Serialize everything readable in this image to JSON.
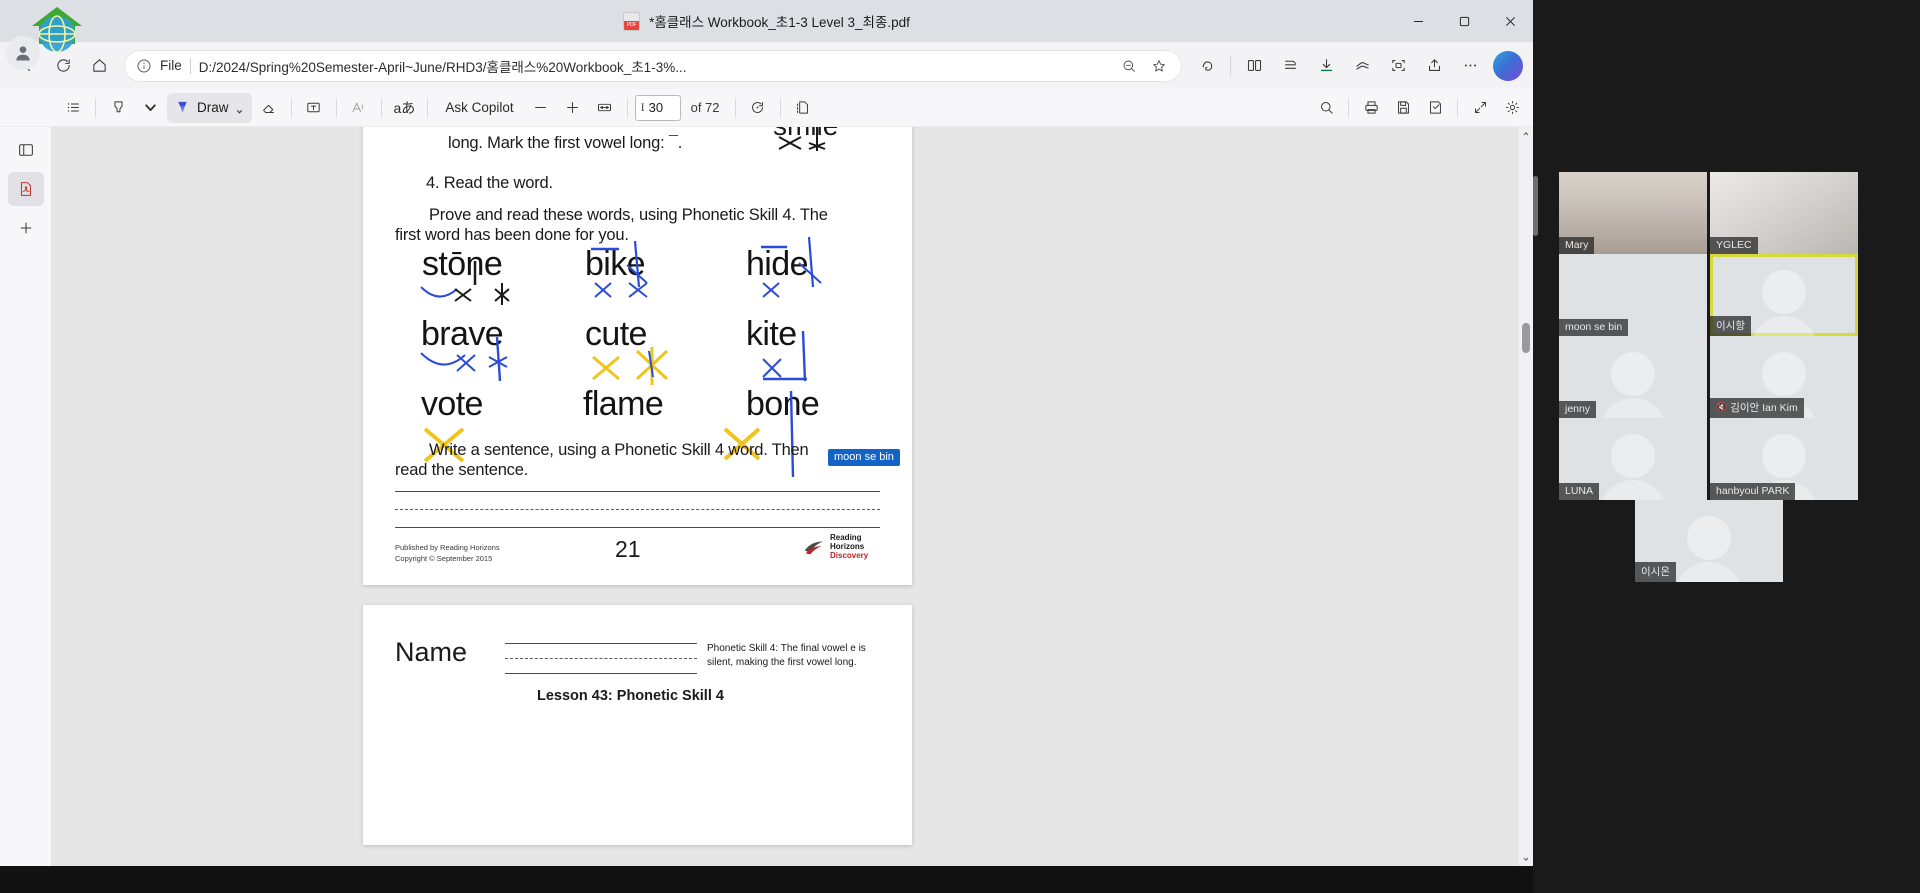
{
  "window": {
    "doc_title": "*홈클래스 Workbook_초1-3 Level 3_최종.pdf",
    "minimize_label": "Minimize",
    "restore_label": "Restore",
    "close_label": "Close"
  },
  "navbar": {
    "back_label": "Back",
    "refresh_label": "Refresh",
    "home_label": "Home",
    "file_scheme": "File",
    "url": "D:/2024/Spring%20Semester-April~June/RHD3/홈클래스%20Workbook_초1-3%...",
    "zoom_out_label": "Zoom out",
    "favorite_label": "Add this page to favorites",
    "copilot_label": "Copilot",
    "split_screen_label": "Split screen",
    "collections_label": "Collections",
    "downloads_label": "Downloads",
    "browser_essentials_label": "Browser essentials",
    "screenshot_label": "Screenshot",
    "share_label": "Share",
    "settings_more_label": "Settings and more"
  },
  "pdf_toolbar": {
    "table_of_contents_label": "Table of contents",
    "highlight_label": "Highlight",
    "draw_label": "Draw",
    "erase_label": "Erase",
    "text_label": "Add text",
    "read_aloud_label": "Read aloud",
    "translate_label": "Translate",
    "ask_copilot_label": "Ask Copilot",
    "zoom_out_label": "Zoom out",
    "zoom_in_label": "Zoom in",
    "fit_page_label": "Fit to page",
    "current_page": "30",
    "page_count_label": "of 72",
    "rotate_label": "Rotate",
    "page_view_label": "Page view",
    "find_label": "Find",
    "print_label": "Print",
    "save_label": "Save",
    "save_as_label": "Save as",
    "fullscreen_label": "Full screen",
    "settings_label": "Settings"
  },
  "pdf_sidebar": {
    "panel_label": "Toggle side panel",
    "pdf_label": "PDF tools",
    "add_label": "Add"
  },
  "worksheet": {
    "instruction_top": "long. Mark the first vowel long: ¯.",
    "step_heading": "4. Read the word.",
    "prove_line1": "Prove and read these words, using Phonetic Skill 4. The",
    "prove_line2": "first word has been done for you.",
    "words": [
      [
        "stōne",
        "bike",
        "hide"
      ],
      [
        "brave",
        "cute",
        "kite"
      ],
      [
        "vote",
        "flame",
        "bone"
      ]
    ],
    "write_line1": "Write a sentence, using a Phonetic Skill 4 word. Then",
    "write_line2": "read the sentence.",
    "annotation_label": "moon se bin",
    "footer_publisher": "Published by Reading Horizons",
    "footer_copyright": "Copyright © September 2015",
    "logo_line1": "Reading",
    "logo_line2": "Horizons",
    "logo_line3": "Discovery",
    "page_number": "21"
  },
  "worksheet_next": {
    "name_label": "Name",
    "note_line1": "Phonetic Skill 4: The final vowel e is",
    "note_line2": "silent, making the first vowel long.",
    "lesson_title": "Lesson 43: Phonetic Skill 4"
  },
  "video_panel": {
    "participants": [
      {
        "name": "Mary",
        "style": "photo-a",
        "speaking": false,
        "muted": false
      },
      {
        "name": "YGLEC",
        "style": "photo-b",
        "speaking": false,
        "muted": false
      },
      {
        "name": "moon se bin",
        "style": "blank",
        "speaking": false,
        "muted": false
      },
      {
        "name": "이시항",
        "style": "ghost",
        "speaking": true,
        "muted": false
      },
      {
        "name": "jenny",
        "style": "ghost",
        "speaking": false,
        "muted": false
      },
      {
        "name": "김이안 Ian Kim",
        "style": "ghost",
        "speaking": false,
        "muted": true
      },
      {
        "name": "LUNA",
        "style": "ghost",
        "speaking": false,
        "muted": false
      },
      {
        "name": "hanbyoul PARK",
        "style": "ghost",
        "speaking": false,
        "muted": false
      },
      {
        "name": "이시온",
        "style": "ghost",
        "speaking": false,
        "muted": false
      }
    ]
  },
  "colors": {
    "accent_blue": "#1464c8",
    "speaking_outline": "#d6d93a",
    "pdf_red": "#e8453c"
  }
}
